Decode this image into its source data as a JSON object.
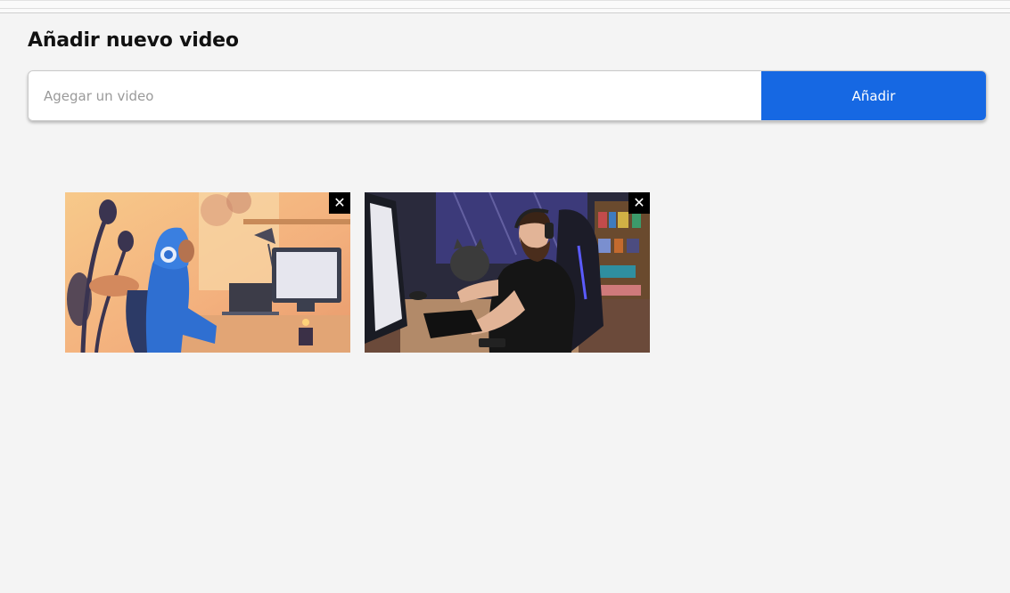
{
  "header": {
    "title": "Añadir nuevo video"
  },
  "form": {
    "placeholder": "Agegar un video",
    "value": "",
    "submit_label": "Añadir",
    "accent_color": "#1668e3"
  },
  "videos": [
    {
      "thumbnail": "lofi-coder-girl-headphones-illustration",
      "remove_icon": "close-icon",
      "remove_glyph": "✕"
    },
    {
      "thumbnail": "bearded-man-gaming-desk-cat-illustration",
      "remove_icon": "close-icon",
      "remove_glyph": "✕"
    }
  ]
}
